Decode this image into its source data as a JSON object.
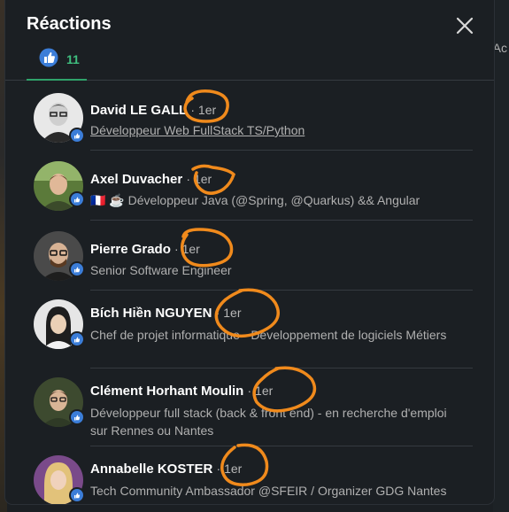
{
  "background": {
    "peek_text": "Ac"
  },
  "modal": {
    "title": "Réactions",
    "tab_count": "11"
  },
  "reactions": [
    {
      "name": "David LE GALL",
      "degree": "· 1er",
      "headline": "Développeur Web FullStack TS/Python"
    },
    {
      "name": "Axel Duvacher",
      "degree": "· 1er",
      "headline": "🇫🇷 ☕ Développeur Java (@Spring, @Quarkus) && Angular"
    },
    {
      "name": "Pierre Grado",
      "degree": "· 1er",
      "headline": "Senior Software Engineer"
    },
    {
      "name": "Bích Hiền NGUYEN",
      "degree": "· 1er",
      "headline": "Chef de projet informatique - Développement de logiciels Métiers"
    },
    {
      "name": "Clément Horhant Moulin",
      "degree": "· 1er",
      "headline": "Développeur full stack (back & front end) - en recherche d'emploi sur Rennes ou Nantes"
    },
    {
      "name": "Annabelle KOSTER",
      "degree": "· 1er",
      "headline": "Tech Community Ambassador @SFEIR / Organizer GDG Nantes"
    }
  ],
  "colors": {
    "accent": "#3fbf7f",
    "annotation": "#f08a1c",
    "like_blue": "#3b7dd8"
  }
}
